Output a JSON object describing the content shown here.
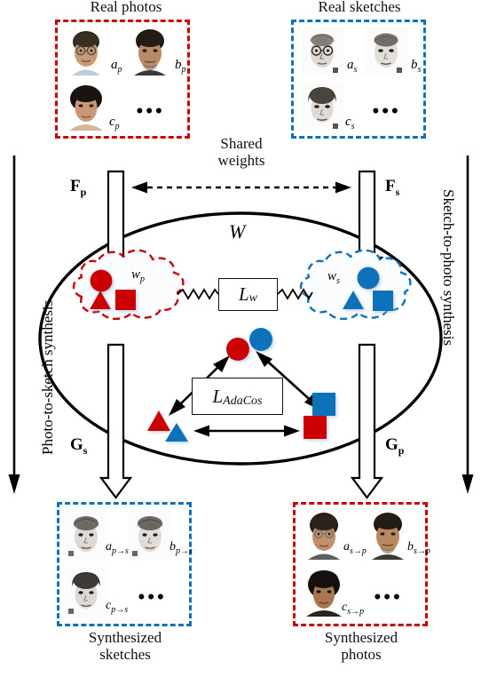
{
  "figure": {
    "title_top_left": "Real photos",
    "title_top_right": "Real sketches",
    "title_bottom_left_line1": "Synthesized",
    "title_bottom_left_line2": "sketches",
    "title_bottom_right_line1": "Synthesized",
    "title_bottom_right_line2": "photos",
    "shared_weights_line1": "Shared",
    "shared_weights_line2": "weights",
    "embedding_space_label": "W",
    "side_label_left": "Photo-to-sketch synthesis",
    "side_label_right": "Sketch-to-photo synthesis",
    "ellipsis": "•••"
  },
  "encoders": {
    "photo_encoder": "F",
    "photo_encoder_sub": "p",
    "sketch_encoder": "F",
    "sketch_encoder_sub": "s"
  },
  "generators": {
    "sketch_generator": "G",
    "sketch_generator_sub": "s",
    "photo_generator": "G",
    "photo_generator_sub": "p"
  },
  "losses": {
    "weight_loss_main": "L",
    "weight_loss_sub": "w",
    "adacos_loss_main": "L",
    "adacos_loss_sub": "AdaCos"
  },
  "clouds": {
    "photo_cloud_label_main": "w",
    "photo_cloud_label_sub": "p",
    "sketch_cloud_label_main": "w",
    "sketch_cloud_label_sub": "s"
  },
  "panels": {
    "real_photos": {
      "border_color": "#cc0000",
      "items": [
        {
          "label_main": "a",
          "label_sub": "p",
          "kind": "photo-glasses-male"
        },
        {
          "label_main": "b",
          "label_sub": "p",
          "kind": "photo-male"
        },
        {
          "label_main": "c",
          "label_sub": "p",
          "kind": "photo-female"
        }
      ]
    },
    "real_sketches": {
      "border_color": "#0d72b9",
      "items": [
        {
          "label_main": "a",
          "label_sub": "s",
          "kind": "sketch-glasses-male"
        },
        {
          "label_main": "b",
          "label_sub": "s",
          "kind": "sketch-male"
        },
        {
          "label_main": "c",
          "label_sub": "s",
          "kind": "sketch-female"
        }
      ]
    },
    "synthesized_sketches": {
      "border_color": "#0d72b9",
      "items": [
        {
          "label_main": "a",
          "label_sub": "p→s",
          "kind": "synth-sketch-1"
        },
        {
          "label_main": "b",
          "label_sub": "p→s",
          "kind": "synth-sketch-2"
        },
        {
          "label_main": "c",
          "label_sub": "p→s",
          "kind": "synth-sketch-3"
        }
      ]
    },
    "synthesized_photos": {
      "border_color": "#cc0000",
      "items": [
        {
          "label_main": "a",
          "label_sub": "s→p",
          "kind": "synth-photo-1"
        },
        {
          "label_main": "b",
          "label_sub": "s→p",
          "kind": "synth-photo-2"
        },
        {
          "label_main": "c",
          "label_sub": "s→p",
          "kind": "synth-photo-3"
        }
      ]
    }
  },
  "colors": {
    "red": "#cc0000",
    "blue": "#0d72b9",
    "black": "#000000"
  }
}
